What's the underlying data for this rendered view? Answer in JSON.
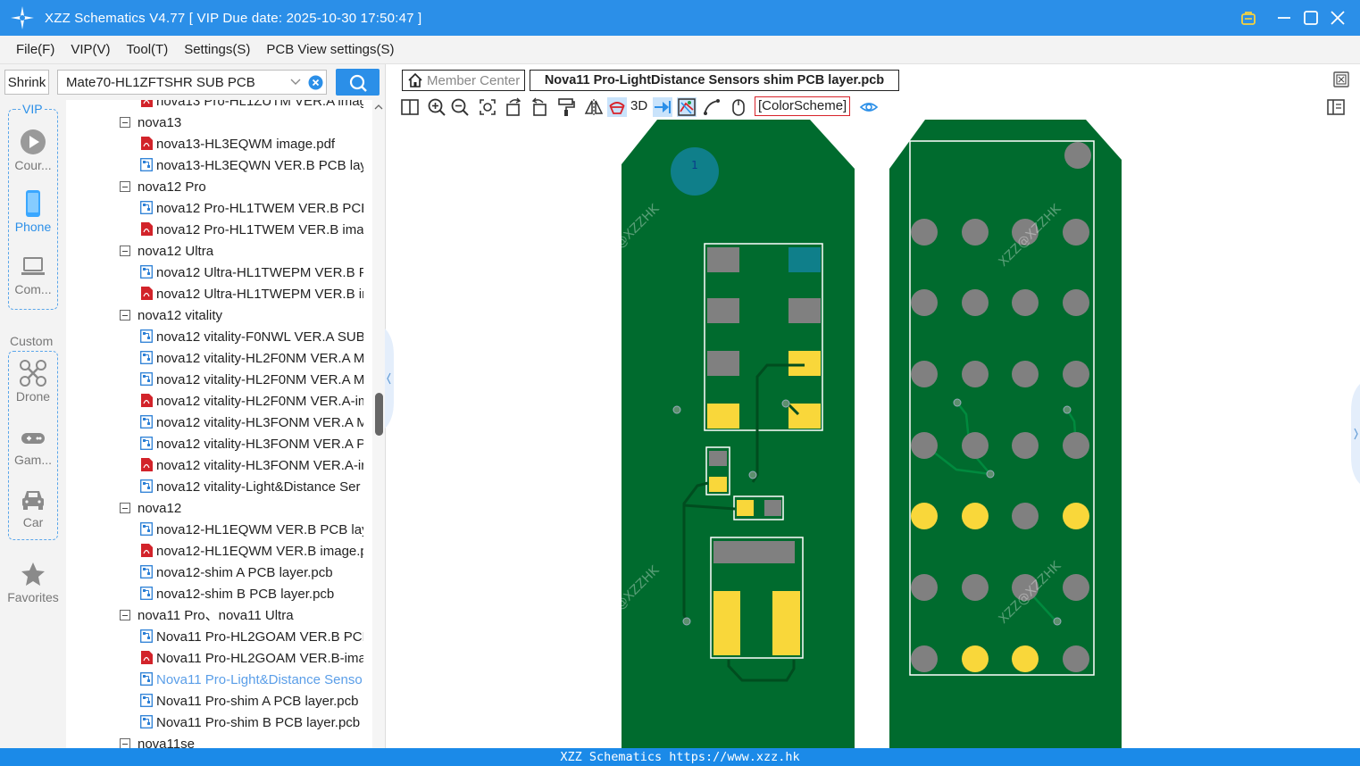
{
  "app": {
    "title": "XZZ Schematics V4.77 [ VIP Due date: 2025-10-30 17:50:47 ]"
  },
  "menu": [
    "File(F)",
    "VIP(V)",
    "Tool(T)",
    "Settings(S)",
    "PCB View settings(S)"
  ],
  "search": {
    "shrink_label": "Shrink",
    "pcb_value": "Mate70-HL1ZFTSHR SUB PCB"
  },
  "nav": {
    "vip_label": "VIP",
    "custom_label": "Custom",
    "items": [
      {
        "label": "Cour...",
        "icon": "play-icon"
      },
      {
        "label": "Phone",
        "icon": "phone-icon"
      },
      {
        "label": "Com...",
        "icon": "laptop-icon"
      },
      {
        "label": "Drone",
        "icon": "drone-icon"
      },
      {
        "label": "Gam...",
        "icon": "gamepad-icon"
      },
      {
        "label": "Car",
        "icon": "car-icon"
      },
      {
        "label": "Favorites",
        "icon": "star-icon"
      }
    ]
  },
  "tree": [
    {
      "type": "file",
      "kind": "pdf",
      "label": "nova13 Pro-HL1ZUTM VER.A imag"
    },
    {
      "type": "folder",
      "label": "nova13"
    },
    {
      "type": "file",
      "kind": "pdf",
      "label": "nova13-HL3EQWM image.pdf"
    },
    {
      "type": "file",
      "kind": "pcb",
      "label": "nova13-HL3EQWN VER.B PCB layer"
    },
    {
      "type": "folder",
      "label": "nova12 Pro"
    },
    {
      "type": "file",
      "kind": "pcb",
      "label": "nova12 Pro-HL1TWEM VER.B PCB l"
    },
    {
      "type": "file",
      "kind": "pdf",
      "label": "nova12 Pro-HL1TWEM VER.B imag"
    },
    {
      "type": "folder",
      "label": "nova12 Ultra"
    },
    {
      "type": "file",
      "kind": "pcb",
      "label": "nova12 Ultra-HL1TWEPM VER.B PC"
    },
    {
      "type": "file",
      "kind": "pdf",
      "label": "nova12 Ultra-HL1TWEPM VER.B im"
    },
    {
      "type": "folder",
      "label": "nova12 vitality"
    },
    {
      "type": "file",
      "kind": "pcb",
      "label": "nova12 vitality-F0NWL VER.A SUB I"
    },
    {
      "type": "file",
      "kind": "pcb",
      "label": "nova12 vitality-HL2F0NM VER.A M"
    },
    {
      "type": "file",
      "kind": "pcb",
      "label": "nova12 vitality-HL2F0NM VER.A M"
    },
    {
      "type": "file",
      "kind": "pdf",
      "label": "nova12 vitality-HL2F0NM VER.A-im"
    },
    {
      "type": "file",
      "kind": "pcb",
      "label": "nova12 vitality-HL3FONM VER.A M"
    },
    {
      "type": "file",
      "kind": "pcb",
      "label": "nova12 vitality-HL3FONM VER.A P("
    },
    {
      "type": "file",
      "kind": "pdf",
      "label": "nova12 vitality-HL3FONM VER.A-ir"
    },
    {
      "type": "file",
      "kind": "pcb",
      "label": "nova12 vitality-Light&Distance Ser"
    },
    {
      "type": "folder",
      "label": "nova12"
    },
    {
      "type": "file",
      "kind": "pcb",
      "label": "nova12-HL1EQWM VER.B PCB laye"
    },
    {
      "type": "file",
      "kind": "pdf",
      "label": "nova12-HL1EQWM VER.B image.p("
    },
    {
      "type": "file",
      "kind": "pcb",
      "label": "nova12-shim A PCB layer.pcb"
    },
    {
      "type": "file",
      "kind": "pcb",
      "label": "nova12-shim B PCB layer.pcb"
    },
    {
      "type": "folder",
      "label": "nova11 Pro、nova11 Ultra"
    },
    {
      "type": "file",
      "kind": "pcb",
      "label": "Nova11 Pro-HL2GOAM VER.B PCB"
    },
    {
      "type": "file",
      "kind": "pdf",
      "label": "Nova11 Pro-HL2GOAM VER.B-imag"
    },
    {
      "type": "file",
      "kind": "pcb",
      "label": "Nova11 Pro-Light&Distance Senso",
      "selected": true
    },
    {
      "type": "file",
      "kind": "pcb",
      "label": "Nova11 Pro-shim A PCB layer.pcb"
    },
    {
      "type": "file",
      "kind": "pcb",
      "label": "Nova11 Pro-shim B PCB layer.pcb"
    },
    {
      "type": "folder",
      "label": "nova11se"
    }
  ],
  "tabs": {
    "member_center": "Member Center",
    "active_file": "Nova11 Pro-LightDistance Sensors shim PCB layer.pcb"
  },
  "toolbar": {
    "label_3d": "3D",
    "color_scheme": "[ColorScheme]"
  },
  "watermark": "XZZ@XZZHK",
  "status": "XZZ Schematics https://www.xzz.hk",
  "colors": {
    "accent": "#2b8fe8",
    "pcb_green": "#006b2e",
    "pad_grey": "#808080",
    "pad_yellow": "#f9d73a",
    "teal": "#0f7f8a"
  }
}
